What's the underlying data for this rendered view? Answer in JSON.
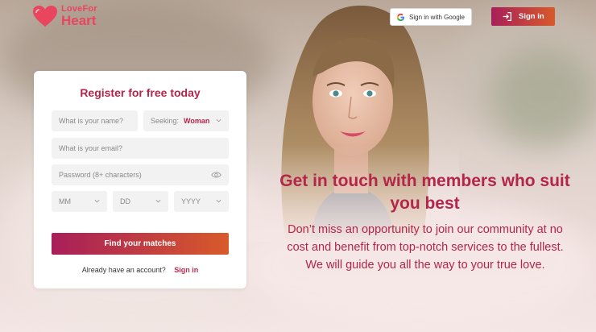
{
  "brand": {
    "line1": "LoveFor",
    "line2": "Heart",
    "color": "#e9455e"
  },
  "header": {
    "google_label": "Sign in with Google",
    "google_icon": "google-g-icon",
    "signin_label": "Sign in",
    "signin_icon": "sign-in-arrow-icon"
  },
  "form": {
    "title": "Register for free today",
    "name_placeholder": "What is your name?",
    "seeking_label": "Seeking:",
    "seeking_value": "Woman",
    "email_placeholder": "What is your email?",
    "password_placeholder": "Password (8+ characters)",
    "month_placeholder": "MM",
    "day_placeholder": "DD",
    "year_placeholder": "YYYY",
    "submit_label": "Find your matches",
    "already_text": "Already have an account?",
    "signin_link": "Sign in"
  },
  "hero": {
    "headline": "Get in touch with members who suit you best",
    "subtext": "Don’t miss an opportunity to join our community at no cost and benefit from top-notch services to the fullest. We will guide you all the way to your true love."
  },
  "colors": {
    "accent": "#b3264a",
    "gradient_start": "#a81e5a",
    "gradient_end": "#d85a2a"
  }
}
